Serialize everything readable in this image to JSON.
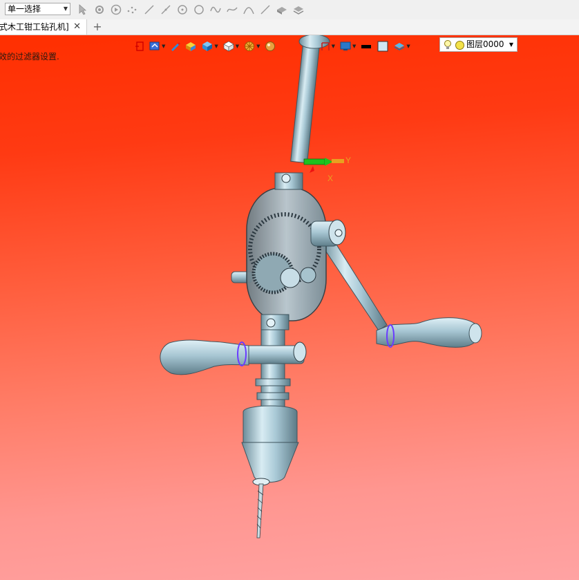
{
  "toolbar": {
    "selection_mode": "单一选择",
    "icons": [
      "cursor-icon",
      "filter-select-icon",
      "play-icon",
      "point-cloud-icon",
      "line-icon",
      "diagonal-line-icon",
      "circle-point-icon",
      "circle-icon",
      "curve-icon",
      "spline-icon",
      "arc-icon",
      "slash-line-icon",
      "solid-tool-icon",
      "layer-stack-icon"
    ]
  },
  "tabs": [
    {
      "label": "式木工钳工钻孔机]",
      "close_label": "✕"
    }
  ],
  "add_tab_label": "+",
  "viewport": {
    "status_text": "效的过滤器设置."
  },
  "view_toolbar": {
    "icons": [
      "exit-view-icon",
      "display-mode-icon",
      "pen-icon",
      "shaded-box-icon",
      "solid-cube-icon",
      "white-cube-icon",
      "sunburst-icon",
      "sphere-icon",
      "frame-icon",
      "monitor-icon",
      "black-line-icon",
      "square-icon",
      "layer-color-icon"
    ],
    "layer_label": "图层0000"
  },
  "axis": {
    "y_label": "Y",
    "x_label": "X"
  },
  "colors": {
    "background_top": "#ff2f00",
    "background_bottom": "#ffa3a3",
    "model": "#9fc4d2",
    "axis_green": "#1ec21e",
    "axis_orange": "#e8a020"
  }
}
